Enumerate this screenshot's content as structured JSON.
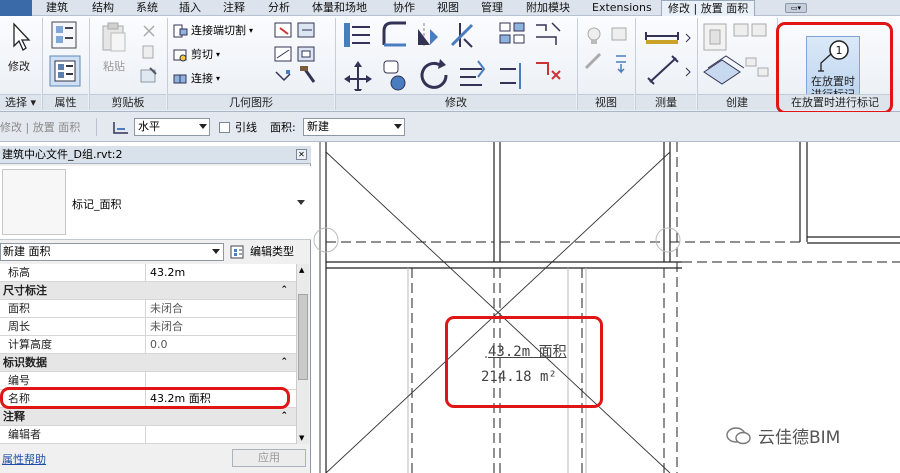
{
  "ribbon": {
    "tabs": [
      "建筑",
      "结构",
      "系统",
      "插入",
      "注释",
      "分析",
      "体量和场地",
      "协作",
      "视图",
      "管理",
      "附加模块",
      "Extensions",
      "修改 | 放置 面积"
    ],
    "active_tab": "修改 | 放置 面积",
    "panels": {
      "select": "选择",
      "properties": "属性",
      "clipboard": "剪贴板",
      "geometry": "几何图形",
      "modify": "修改",
      "view": "视图",
      "measure": "测量",
      "create": "创建",
      "tag": "在放置时进行标记"
    },
    "buttons": {
      "modify": "修改",
      "paste": "粘贴",
      "join_cut": "连接端切割",
      "cut": "剪切",
      "join": "连接",
      "tag_on_place_line1": "在放置时",
      "tag_on_place_line2": "进行标记"
    }
  },
  "options_bar": {
    "context": "修改 | 放置 面积",
    "orientation": "水平",
    "leader_label": "引线",
    "area_label": "面积:",
    "area_value": "新建"
  },
  "properties": {
    "title": "建筑中心文件_D组.rvt:2",
    "type_name": "标记_面积",
    "instance_selector": "新建 面积",
    "edit_type": "编辑类型",
    "rows": [
      {
        "kind": "param",
        "key": "标高",
        "value": "43.2m"
      },
      {
        "kind": "group",
        "key": "尺寸标注",
        "value": ""
      },
      {
        "kind": "param",
        "key": "面积",
        "value": "未闭合"
      },
      {
        "kind": "param",
        "key": "周长",
        "value": "未闭合"
      },
      {
        "kind": "param",
        "key": "计算高度",
        "value": "0.0"
      },
      {
        "kind": "group",
        "key": "标识数据",
        "value": ""
      },
      {
        "kind": "param",
        "key": "编号",
        "value": ""
      },
      {
        "kind": "param",
        "key": "名称",
        "value": "43.2m 面积"
      },
      {
        "kind": "group",
        "key": "注释",
        "value": ""
      },
      {
        "kind": "param",
        "key": "编辑者",
        "value": ""
      }
    ],
    "help": "属性帮助",
    "apply": "应用"
  },
  "canvas": {
    "tag_name": "43.2m 面积",
    "tag_area": "214.18 m²"
  },
  "watermark": "云佳德BIM",
  "colors": {
    "highlight": "#e01515",
    "link": "#1d4fa8",
    "active_button": "#b8d1ee"
  }
}
